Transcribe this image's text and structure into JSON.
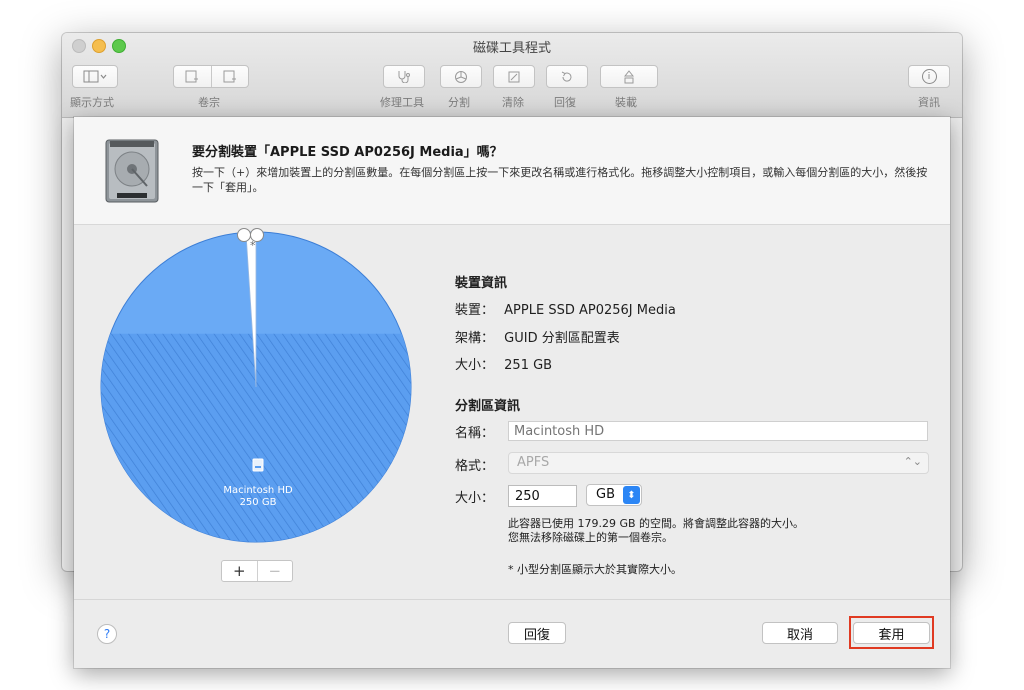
{
  "window": {
    "title": "磁碟工具程式"
  },
  "toolbar": {
    "view_label": "顯示方式",
    "volume_label": "卷宗",
    "first_aid_label": "修理工具",
    "partition_label": "分割",
    "erase_label": "清除",
    "restore_label": "回復",
    "mount_label": "裝載",
    "info_label": "資訊",
    "view_icon": "sidebar-icon",
    "view_chevron": "chevron-down-icon",
    "info_glyph": "i"
  },
  "sheet": {
    "title": "要分割裝置「APPLE SSD AP0256J Media」嗎？",
    "description": "按一下（+）來增加裝置上的分割區數量。在每個分割區上按一下來更改名稱或進行格式化。拖移調整大小控制項目，或輸入每個分割區的大小，然後按一下「套用」。"
  },
  "pie": {
    "partition_name": "Macintosh HD",
    "partition_size": "250 GB",
    "small_mark": "*",
    "used_fraction": 0.7143,
    "primary_color": "#5b9ef0",
    "plus_label": "+",
    "minus_label": "−"
  },
  "device_info": {
    "heading": "裝置資訊",
    "device_key": "裝置：",
    "device_value": "APPLE SSD AP0256J Media",
    "scheme_key": "架構：",
    "scheme_value": "GUID 分割區配置表",
    "size_key": "大小：",
    "size_value": "251 GB"
  },
  "partition_info": {
    "heading": "分割區資訊",
    "name_key": "名稱：",
    "name_placeholder": "Macintosh HD",
    "format_key": "格式：",
    "format_value": "APFS",
    "size_key": "大小：",
    "size_value": "250",
    "unit_value": "GB",
    "note_line1": "此容器已使用 179.29 GB 的空間。將會調整此容器的大小。",
    "note_line2": "您無法移除磁碟上的第一個卷宗。",
    "footnote": "* 小型分割區顯示大於其實際大小。"
  },
  "footer": {
    "help_label": "?",
    "revert_label": "回復",
    "cancel_label": "取消",
    "apply_label": "套用",
    "highlight_color": "#e03a22"
  }
}
